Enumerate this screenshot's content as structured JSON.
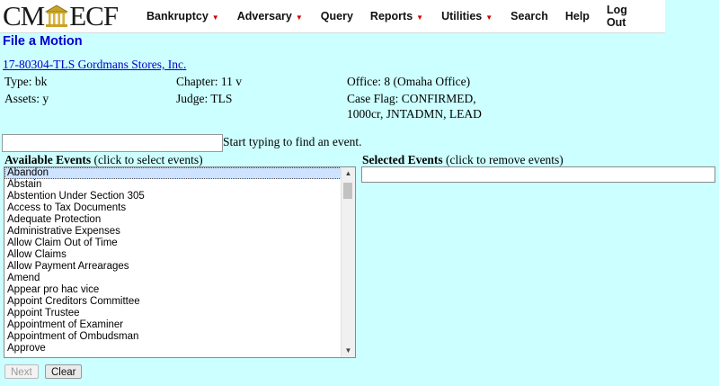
{
  "logo": {
    "left": "CM",
    "right": "ECF"
  },
  "nav": [
    {
      "label": "Bankruptcy",
      "caret": true
    },
    {
      "label": "Adversary",
      "caret": true
    },
    {
      "label": "Query",
      "caret": false
    },
    {
      "label": "Reports",
      "caret": true
    },
    {
      "label": "Utilities",
      "caret": true
    },
    {
      "label": "Search",
      "caret": false
    },
    {
      "label": "Help",
      "caret": false
    },
    {
      "label": "Log Out",
      "caret": false
    }
  ],
  "page_title": "File a Motion",
  "case": {
    "link": "17-80304-TLS Gordmans Stores, Inc.",
    "type": "Type: bk",
    "assets": "Assets: y",
    "chapter": "Chapter: 11 v",
    "judge": "Judge: TLS",
    "office": "Office: 8 (Omaha Office)",
    "flag_line1": "Case Flag: CONFIRMED,",
    "flag_line2": "1000cr, JNTADMN, LEAD"
  },
  "search": {
    "hint": "Start typing to find an event.",
    "value": ""
  },
  "available": {
    "label_bold": "Available Events",
    "label_rest": " (click to select events)",
    "items": [
      "Abandon",
      "Abstain",
      "Abstention Under Section 305",
      "Access to Tax Documents",
      "Adequate Protection",
      "Administrative Expenses",
      "Allow Claim Out of Time",
      "Allow Claims",
      "Allow Payment Arrearages",
      "Amend",
      "Appear pro hac vice",
      "Appoint Creditors Committee",
      "Appoint Trustee",
      "Appointment of Examiner",
      "Appointment of Ombudsman",
      "Approve"
    ],
    "selected_index": 0
  },
  "selected": {
    "label_bold": "Selected Events",
    "label_rest": " (click to remove events)"
  },
  "buttons": {
    "next": "Next",
    "clear": "Clear"
  }
}
